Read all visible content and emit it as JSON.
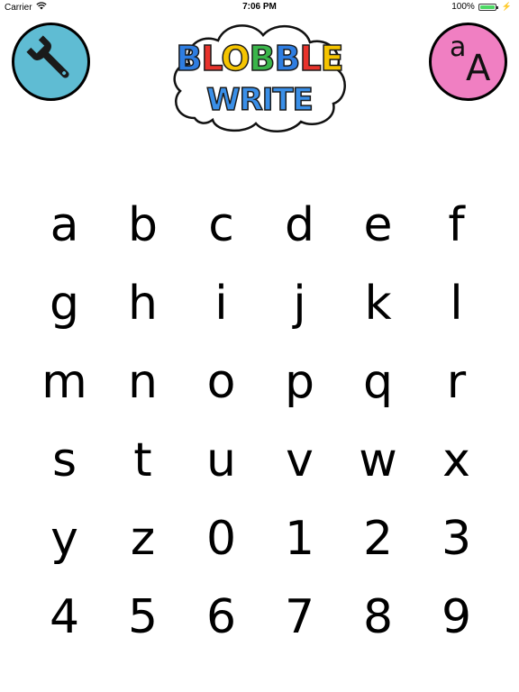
{
  "status_bar": {
    "carrier": "Carrier",
    "time": "7:06 PM",
    "battery": "100%",
    "battery_level": 1.0
  },
  "header": {
    "settings_icon": "wrench-icon",
    "case_toggle": {
      "small": "a",
      "big": "A"
    },
    "logo": {
      "line1": [
        "B",
        "L",
        "O",
        "B",
        "B",
        "L",
        "E"
      ],
      "line2": "WRITE"
    }
  },
  "colors": {
    "settings_button": "#5fbcd3",
    "case_button": "#f07fc2",
    "logo_letters": [
      "#2e7de1",
      "#e8322b",
      "#f5c400",
      "#3ab54a",
      "#2e7de1",
      "#e8322b",
      "#f5c400"
    ],
    "logo_write": "#3a8fe8"
  },
  "characters": [
    "a",
    "b",
    "c",
    "d",
    "e",
    "f",
    "g",
    "h",
    "i",
    "j",
    "k",
    "l",
    "m",
    "n",
    "o",
    "p",
    "q",
    "r",
    "s",
    "t",
    "u",
    "v",
    "w",
    "x",
    "y",
    "z",
    "0",
    "1",
    "2",
    "3",
    "4",
    "5",
    "6",
    "7",
    "8",
    "9"
  ]
}
